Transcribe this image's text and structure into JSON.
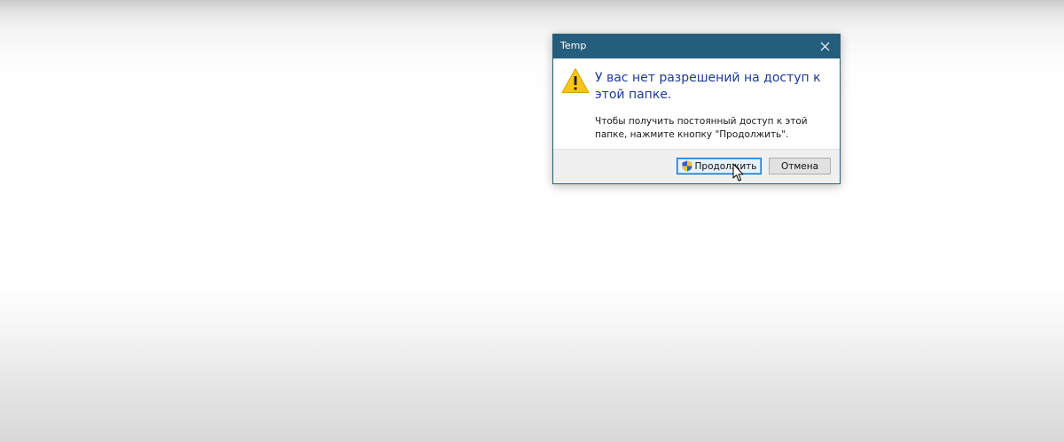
{
  "dialog": {
    "title": "Temp",
    "heading": "У вас нет разрешений на доступ к этой папке.",
    "message": "Чтобы получить постоянный доступ к этой папке, нажмите кнопку \"Продолжить\".",
    "buttons": {
      "continue_label": "Продолжить",
      "cancel_label": "Отмена"
    },
    "icons": {
      "warning": "warning-icon",
      "close": "close-icon",
      "uac_shield": "uac-shield-icon"
    }
  },
  "colors": {
    "titlebar": "#245e7c",
    "heading_text": "#1e3a96",
    "footer": "#f0f0f0",
    "focused_button_border": "#0a73d1",
    "warning_yellow": "#f7c51c"
  }
}
